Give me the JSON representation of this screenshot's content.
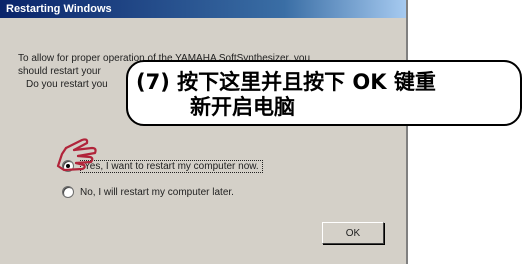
{
  "dialog": {
    "title": "Restarting Windows",
    "message_lines": [
      "To allow for proper operation of the YAMAHA SoftSynthesizer, you",
      "should restart your",
      "Do you restart you"
    ],
    "options": [
      {
        "label": "Yes, I want to restart my computer now.",
        "selected": true
      },
      {
        "label": "No, I will restart my computer later.",
        "selected": false
      }
    ],
    "ok_label": "OK"
  },
  "callout": {
    "line1": "(7) 按下这里并且按下 OK 键重",
    "line2": "新开启电脑"
  },
  "icons": {
    "pointer": "pointing-hand-icon"
  },
  "colors": {
    "titlebar": "#0a246a",
    "dialog_bg": "#d4d0c8"
  }
}
